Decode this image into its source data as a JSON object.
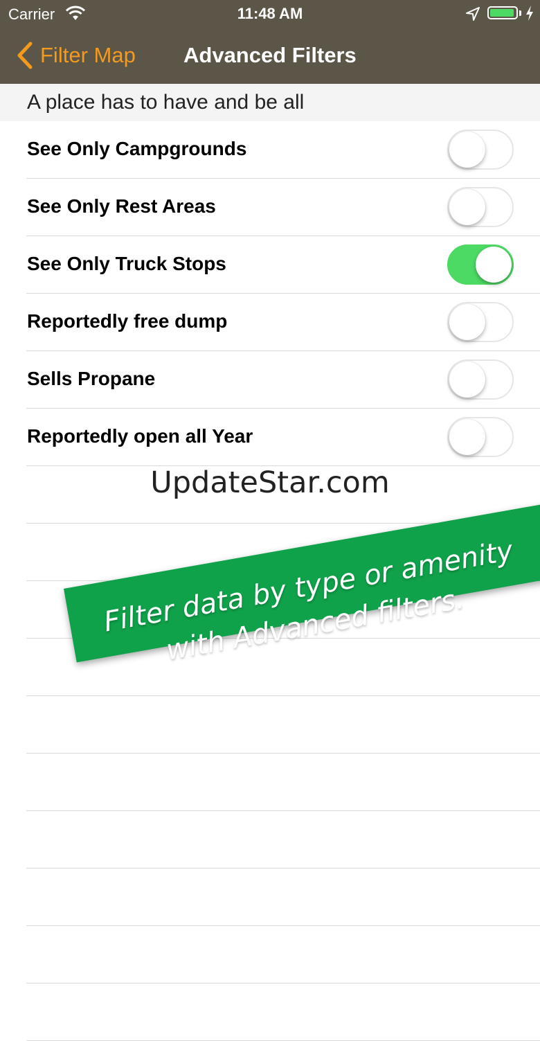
{
  "status_bar": {
    "carrier": "Carrier",
    "time": "11:48 AM",
    "battery_level": 0.95,
    "battery_color": "#4cd964"
  },
  "nav": {
    "back_label": "Filter Map",
    "title": "Advanced Filters",
    "accent_color": "#f39a1f",
    "bar_color": "#5b5647"
  },
  "section_header": "A place has to have and be all",
  "filters": [
    {
      "label": "See Only Campgrounds",
      "on": false
    },
    {
      "label": "See Only Rest Areas",
      "on": false
    },
    {
      "label": "See Only Truck Stops",
      "on": true
    },
    {
      "label": "Reportedly free dump",
      "on": false
    },
    {
      "label": "Sells Propane",
      "on": false
    },
    {
      "label": "Reportedly open all Year",
      "on": false
    }
  ],
  "watermark": "UpdateStar.com",
  "promo_banner": {
    "line1": "Filter data by type or amenity",
    "line2": "with Advanced filters.",
    "color": "#0fa24a"
  }
}
